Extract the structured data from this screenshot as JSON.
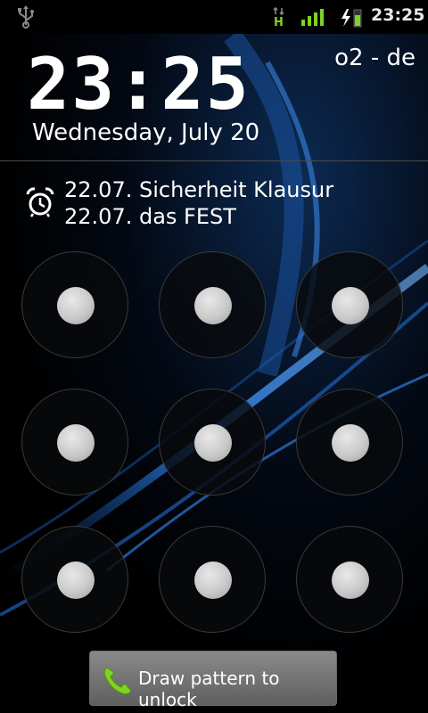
{
  "statusbar": {
    "network_type": "H",
    "time": "23:25",
    "icons": [
      "usb-icon",
      "network-activity-icon",
      "signal-strength-icon",
      "battery-charging-icon"
    ],
    "accent": "#7fd321"
  },
  "lockscreen": {
    "clock": "23:25",
    "carrier": "o2 - de",
    "date": "Wednesday, July 20",
    "alarm_lines": [
      "22.07. Sicherheit Klausur",
      "22.07. das FEST"
    ],
    "unlock_label": "Draw pattern to unlock"
  },
  "pattern_dot_count": 9
}
